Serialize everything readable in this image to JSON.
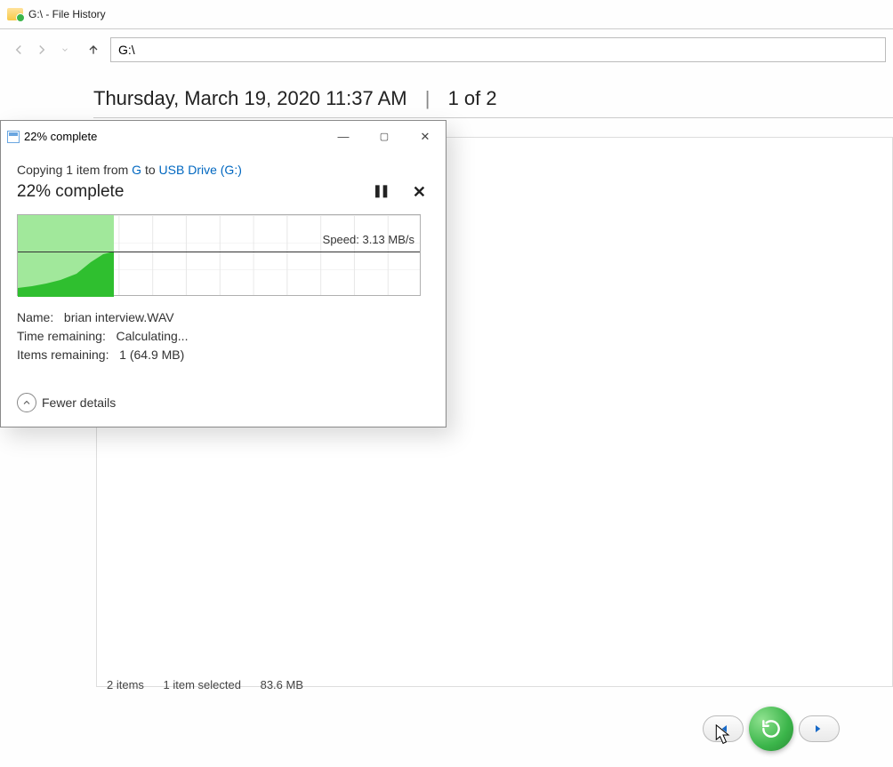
{
  "fileHistory": {
    "windowTitle": "G:\\ - File History",
    "addressPath": "G:\\",
    "snapshotDate": "Thursday, March 19, 2020 11:37 AM",
    "snapshotPosition": "1 of 2",
    "status": {
      "itemCount": "2 items",
      "selection": "1 item selected",
      "size": "83.6 MB"
    }
  },
  "copyDialog": {
    "title": "22% complete",
    "copyLine": {
      "prefix": "Copying 1 item from ",
      "sourceLink": "G",
      "mid": " to ",
      "destLink": "USB Drive (G:)"
    },
    "percentLine": "22% complete",
    "controls": {
      "pause": "❚❚",
      "cancel": "✕"
    },
    "graph": {
      "speedLabel": "Speed: 3.13 MB/s",
      "progressFraction": 0.238
    },
    "details": {
      "nameLabel": "Name:",
      "nameValue": "brian interview.WAV",
      "timeLabel": "Time remaining:",
      "timeValue": "Calculating...",
      "itemsLabel": "Items remaining:",
      "itemsValue": "1 (64.9 MB)"
    },
    "fewerDetails": "Fewer details",
    "windowControls": {
      "minimize": "—",
      "maximize": "▢",
      "close": "✕"
    }
  },
  "chart_data": {
    "type": "area",
    "title": "Speed: 3.13 MB/s",
    "xlabel": "",
    "ylabel": "MB/s",
    "ylim": [
      0,
      5.5
    ],
    "x_progress_pct": [
      0,
      5,
      10,
      14,
      17,
      20,
      22,
      23.8
    ],
    "values_mb_per_s": [
      0.6,
      0.8,
      1.0,
      1.2,
      1.6,
      2.3,
      3.0,
      3.13
    ]
  }
}
